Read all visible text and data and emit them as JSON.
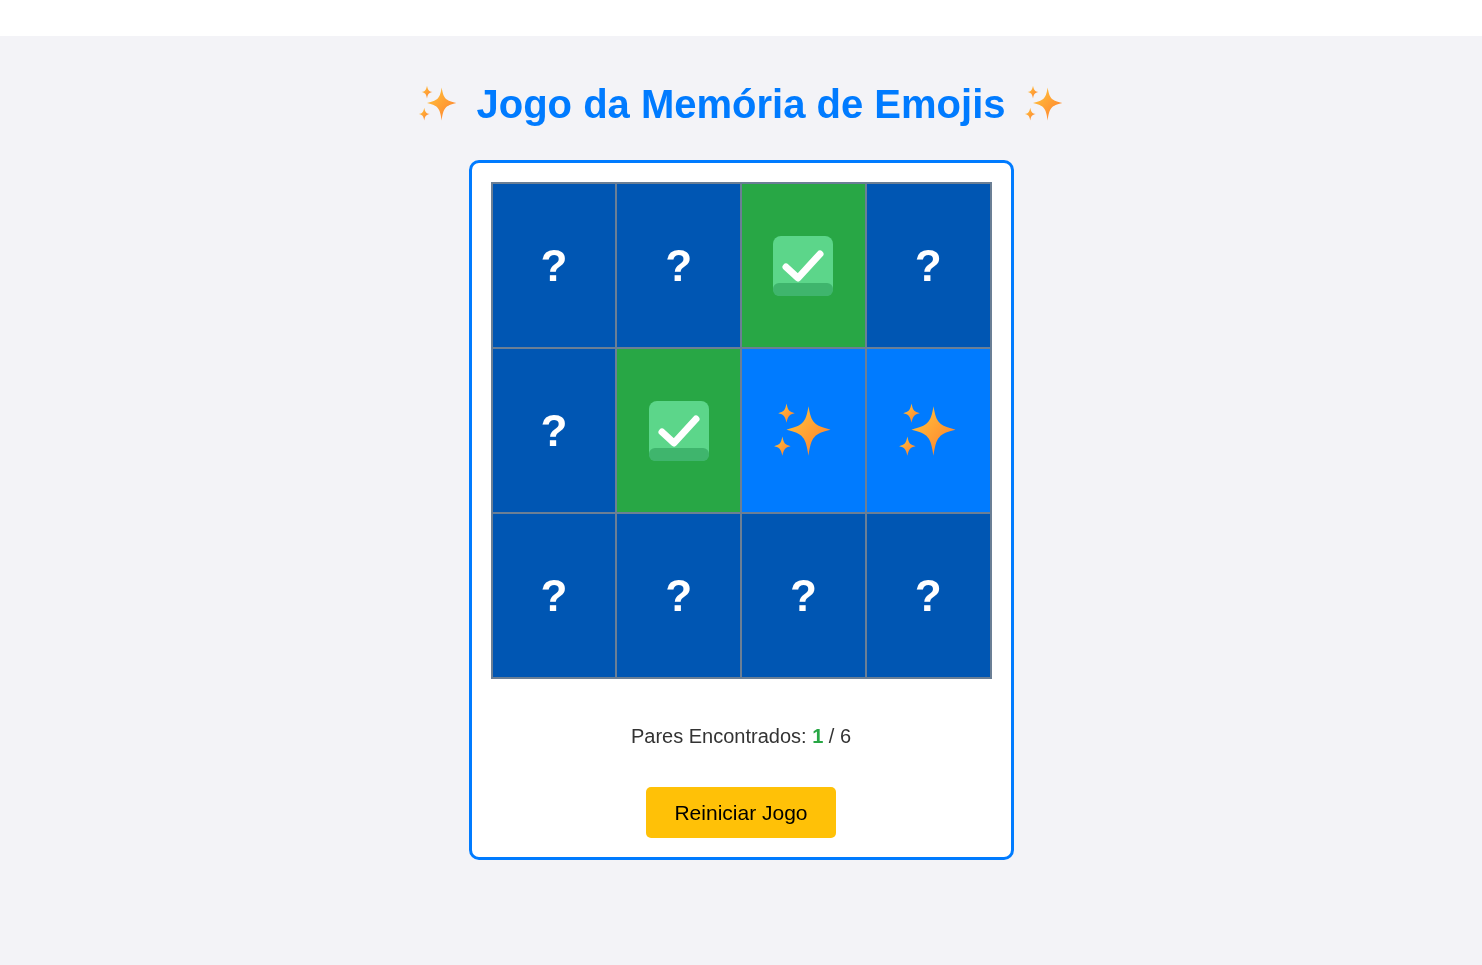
{
  "title": "Jogo da Memória de Emojis",
  "cards": [
    {
      "kind": "hidden",
      "label": "?"
    },
    {
      "kind": "hidden",
      "label": "?"
    },
    {
      "kind": "matched"
    },
    {
      "kind": "hidden",
      "label": "?"
    },
    {
      "kind": "hidden",
      "label": "?"
    },
    {
      "kind": "matched"
    },
    {
      "kind": "flipped"
    },
    {
      "kind": "flipped"
    },
    {
      "kind": "hidden",
      "label": "?"
    },
    {
      "kind": "hidden",
      "label": "?"
    },
    {
      "kind": "hidden",
      "label": "?"
    },
    {
      "kind": "hidden",
      "label": "?"
    }
  ],
  "score": {
    "label": "Pares Encontrados:",
    "found": "1",
    "separator": "/ 6"
  },
  "restart_button": "Reiniciar Jogo"
}
